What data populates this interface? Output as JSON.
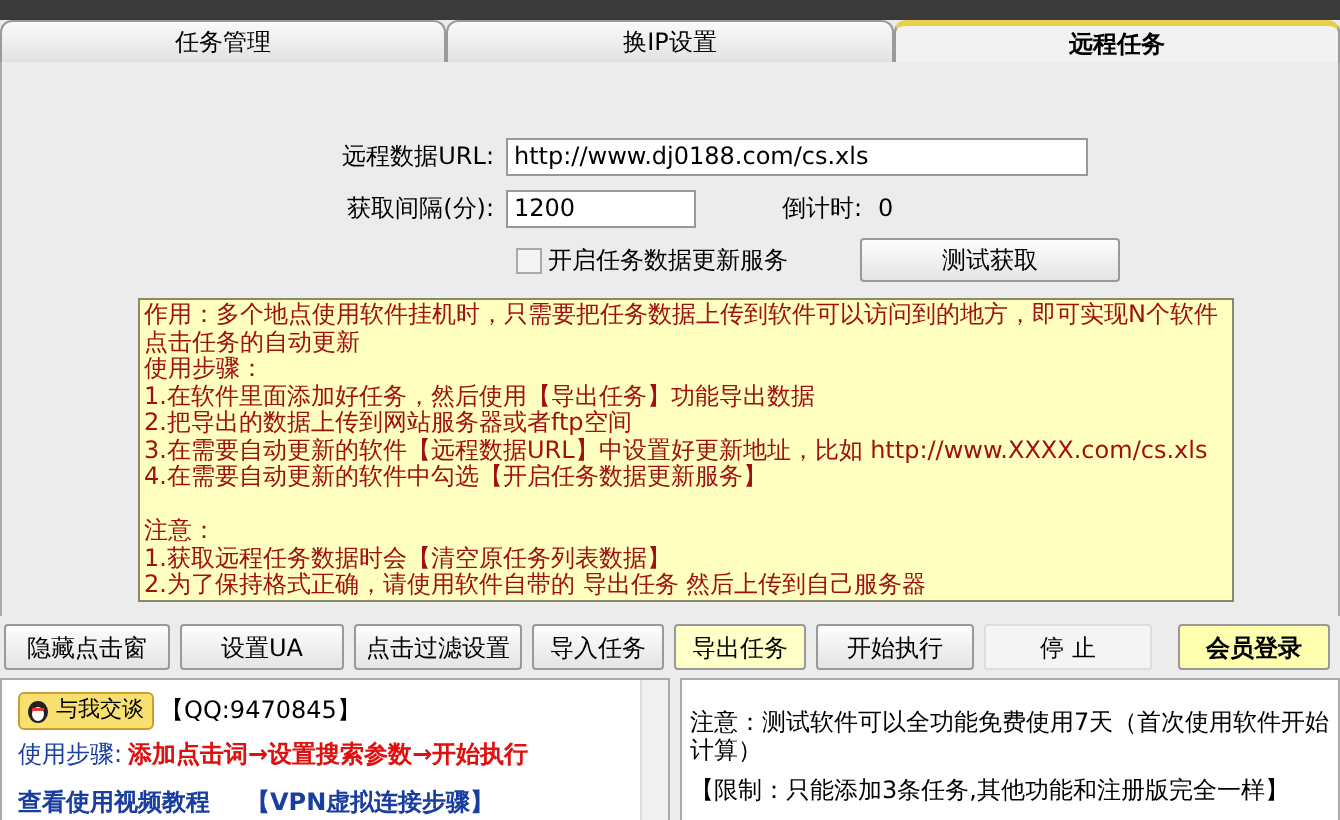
{
  "tabs": [
    {
      "label": "任务管理",
      "selected": false
    },
    {
      "label": "换IP设置",
      "selected": false
    },
    {
      "label": "远程任务",
      "selected": true
    }
  ],
  "remote_form": {
    "url_label": "远程数据URL:",
    "url_value": "http://www.dj0188.com/cs.xls",
    "interval_label": "获取间隔(分):",
    "interval_value": "1200",
    "countdown_label": "倒计时:",
    "countdown_value": "0",
    "service_checkbox": {
      "label": "开启任务数据更新服务",
      "checked": false
    },
    "test_button": "测试获取"
  },
  "instructions": [
    [
      "作用：多个地点使用软件挂机时，只需要把任务数据上传到软件可以访问到的地方，即可实现N个软件点击任务的自动更新",
      "使用步骤：",
      "1.在软件里面添加好任务，然后使用【导出任务】功能导出数据",
      "2.把导出的数据上传到网站服务器或者ftp空间",
      "3.在需要自动更新的软件【远程数据URL】中设置好更新地址，比如 http://www.XXXX.com/cs.xls",
      "4.在需要自动更新的软件中勾选【开启任务数据更新服务】"
    ],
    [
      "注意：",
      "1.获取远程任务数据时会【清空原任务列表数据】",
      "2.为了保持格式正确，请使用软件自带的 导出任务 然后上传到自己服务器"
    ]
  ],
  "toolbar": [
    {
      "label": "隐藏点击窗",
      "highlighted": false,
      "disabled": false
    },
    {
      "label": "设置UA",
      "highlighted": false,
      "disabled": false
    },
    {
      "label": "点击过滤设置",
      "highlighted": false,
      "disabled": false
    },
    {
      "label": "导入任务",
      "highlighted": false,
      "disabled": false
    },
    {
      "label": "导出任务",
      "highlighted": true,
      "disabled": false
    },
    {
      "label": "开始执行",
      "highlighted": false,
      "disabled": false
    },
    {
      "label": "停 止",
      "highlighted": false,
      "disabled": true
    }
  ],
  "login_button": "会员登录",
  "info_panel": {
    "chat_button": "与我交谈",
    "qq": "【QQ:9470845】",
    "steps_label": "使用步骤:",
    "steps": "添加点击词→设置搜索参数→开始执行",
    "video_link": "查看使用视频教程",
    "vpn_link": "【VPN虚拟连接步骤】"
  },
  "notice_panel": [
    "注意：测试软件可以全功能免费使用7天（首次使用软件开始计算）",
    "【限制：只能添加3条任务,其他功能和注册版完全一样】"
  ]
}
